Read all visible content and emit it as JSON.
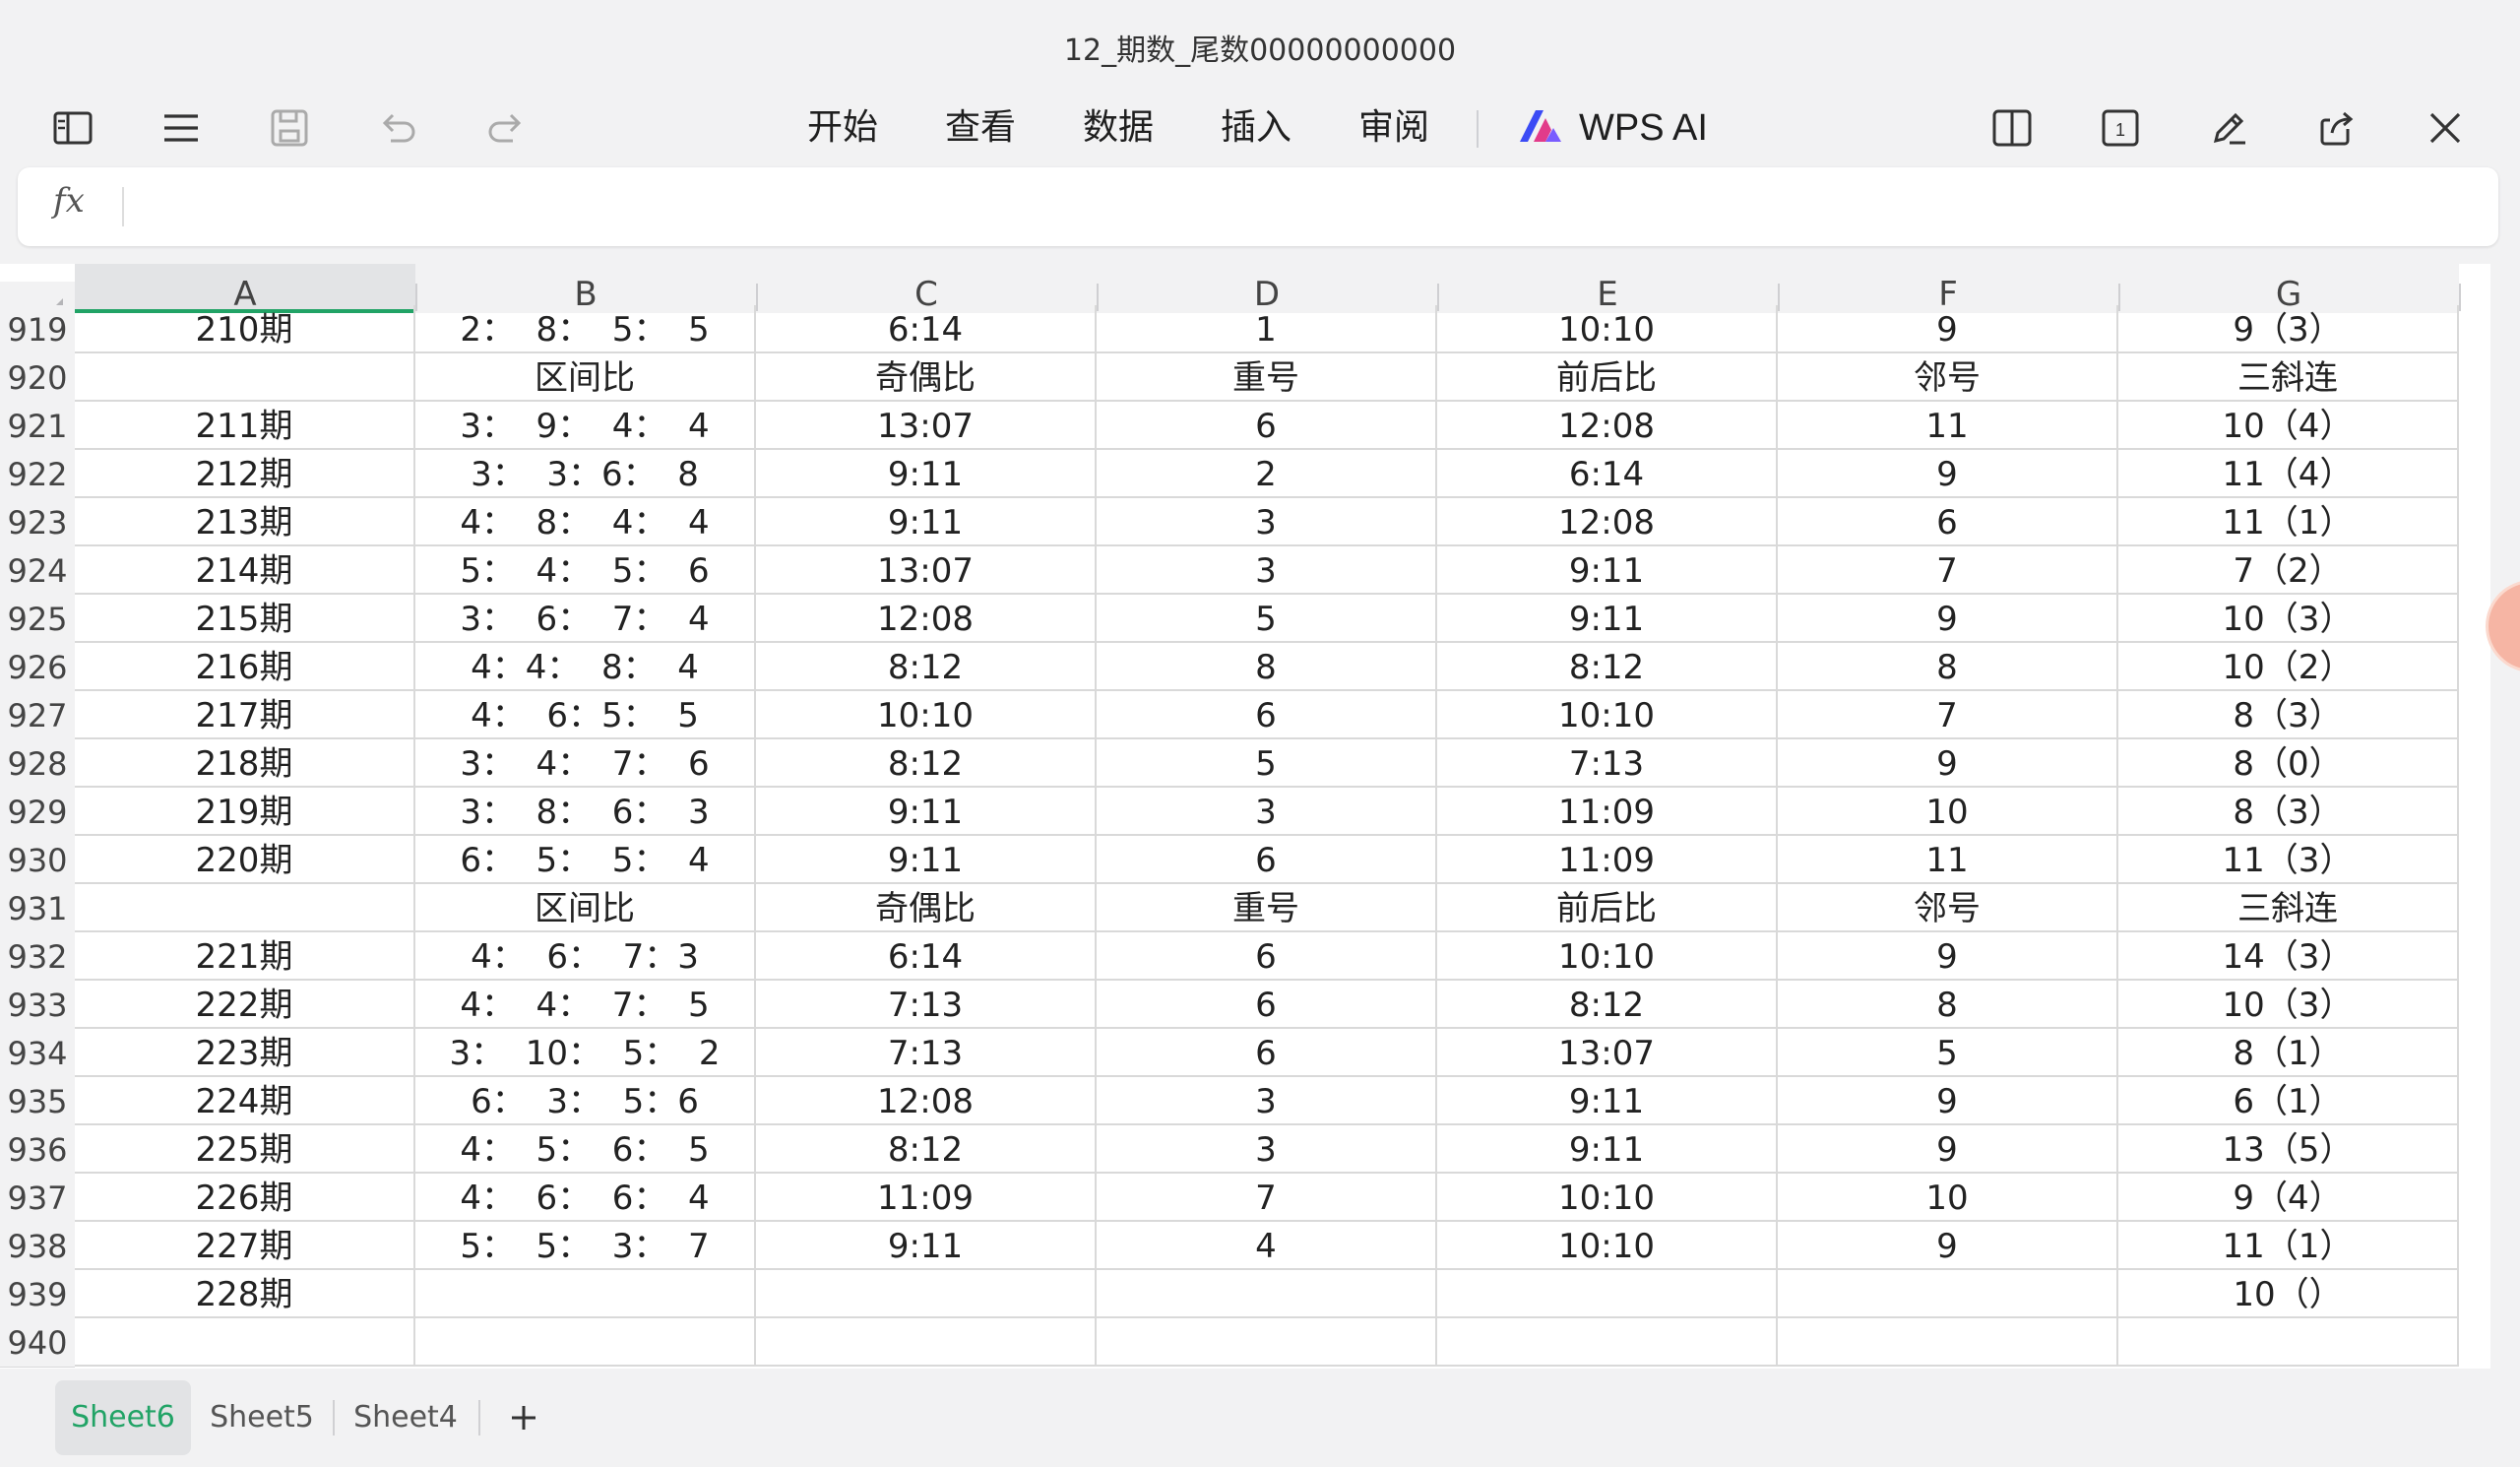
{
  "window": {
    "title": "12_期数_尾数00000000000"
  },
  "toolbar": {
    "menus": [
      "开始",
      "查看",
      "数据",
      "插入",
      "审阅"
    ],
    "ai_label": "WPS AI",
    "page_badge": "1"
  },
  "formula_bar": {
    "fx_label": "fx",
    "value": ""
  },
  "columns": [
    "A",
    "B",
    "C",
    "D",
    "E",
    "F",
    "G"
  ],
  "rows": [
    {
      "num": "919",
      "cells": [
        "210期",
        "2：  8：  5：  5",
        "6:14",
        "1",
        "10:10",
        "9",
        "9（3）"
      ]
    },
    {
      "num": "920",
      "cells": [
        "",
        "区间比",
        "奇偶比",
        "重号",
        "前后比",
        "邻号",
        "三斜连"
      ]
    },
    {
      "num": "921",
      "cells": [
        "211期",
        "3：  9：  4：  4",
        "13:07",
        "6",
        "12:08",
        "11",
        "10（4）"
      ]
    },
    {
      "num": "922",
      "cells": [
        "212期",
        "3：  3：6：  8",
        "9:11",
        "2",
        "6:14",
        "9",
        "11（4）"
      ]
    },
    {
      "num": "923",
      "cells": [
        "213期",
        "4：  8：  4：  4",
        "9:11",
        "3",
        "12:08",
        "6",
        "11（1）"
      ]
    },
    {
      "num": "924",
      "cells": [
        "214期",
        "5：  4：  5：  6",
        "13:07",
        "3",
        "9:11",
        "7",
        "7（2）"
      ]
    },
    {
      "num": "925",
      "cells": [
        "215期",
        "3：  6：  7：  4",
        "12:08",
        "5",
        "9:11",
        "9",
        "10（3）"
      ]
    },
    {
      "num": "926",
      "cells": [
        "216期",
        "4：4：  8：  4",
        "8:12",
        "8",
        "8:12",
        "8",
        "10（2）"
      ]
    },
    {
      "num": "927",
      "cells": [
        "217期",
        "4：  6：5：  5",
        "10:10",
        "6",
        "10:10",
        "7",
        "8（3）"
      ]
    },
    {
      "num": "928",
      "cells": [
        "218期",
        "3：  4：  7：  6",
        "8:12",
        "5",
        "7:13",
        "9",
        "8（0）"
      ]
    },
    {
      "num": "929",
      "cells": [
        "219期",
        "3：  8：  6：  3",
        "9:11",
        "3",
        "11:09",
        "10",
        "8（3）"
      ]
    },
    {
      "num": "930",
      "cells": [
        "220期",
        "6：  5：  5：  4",
        "9:11",
        "6",
        "11:09",
        "11",
        "11（3）"
      ]
    },
    {
      "num": "931",
      "cells": [
        "",
        "区间比",
        "奇偶比",
        "重号",
        "前后比",
        "邻号",
        "三斜连"
      ]
    },
    {
      "num": "932",
      "cells": [
        "221期",
        "4：  6：  7：3",
        "6:14",
        "6",
        "10:10",
        "9",
        "14（3）"
      ]
    },
    {
      "num": "933",
      "cells": [
        "222期",
        "4：  4：  7：  5",
        "7:13",
        "6",
        "8:12",
        "8",
        "10（3）"
      ]
    },
    {
      "num": "934",
      "cells": [
        "223期",
        "3：  10：  5：  2",
        "7:13",
        "6",
        "13:07",
        "5",
        "8（1）"
      ]
    },
    {
      "num": "935",
      "cells": [
        "224期",
        "6：  3：  5：6",
        "12:08",
        "3",
        "9:11",
        "9",
        "6（1）"
      ]
    },
    {
      "num": "936",
      "cells": [
        "225期",
        "4：  5：  6：  5",
        "8:12",
        "3",
        "9:11",
        "9",
        "13（5）"
      ]
    },
    {
      "num": "937",
      "cells": [
        "226期",
        "4：  6：  6：  4",
        "11:09",
        "7",
        "10:10",
        "10",
        "9（4）"
      ]
    },
    {
      "num": "938",
      "cells": [
        "227期",
        "5：  5：  3：  7",
        "9:11",
        "4",
        "10:10",
        "9",
        "11（1）"
      ]
    },
    {
      "num": "939",
      "cells": [
        "228期",
        "",
        "",
        "",
        "",
        "",
        "10（）"
      ]
    },
    {
      "num": "940",
      "cells": [
        "",
        "",
        "",
        "",
        "",
        "",
        ""
      ]
    }
  ],
  "sheets": [
    {
      "name": "Sheet6",
      "active": true
    },
    {
      "name": "Sheet5",
      "active": false
    },
    {
      "name": "Sheet4",
      "active": false
    }
  ],
  "colors": {
    "accent": "#21a366",
    "active_tab_text": "#21a366"
  }
}
